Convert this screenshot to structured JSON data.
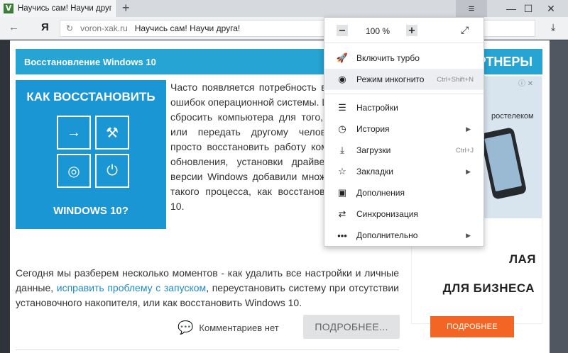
{
  "tab": {
    "favicon": "V",
    "title": "Научись сам! Научи друга",
    "close": "✕"
  },
  "window": {
    "new_tab": "+",
    "menu_icon": "≡",
    "min": "—",
    "max": "☐",
    "close": "✕"
  },
  "toolbar": {
    "back": "←",
    "logo": "Я",
    "refresh": "↻",
    "domain": "voron-xak.ru",
    "page_title": "Научись сам! Научи друга!",
    "download": "⤓"
  },
  "article": {
    "header": "Восстановление Windows 10",
    "image_title": "КАК ВОССТАНОВИТЬ",
    "image_subtitle": "WINDOWS 10?",
    "paragraph1": "Часто появляется потребность в Windows из-за ошибок операционной системы. Или необходимо сбросить компьютера для того, чтобы продать или передать другому человеку. требуется просто восстановить работу компьютера после обновления, установки драйверов последней версии Windows добавили множество функций, такого процесса, как восстановление Windows 10.",
    "paragraph2_part1": "Сегодня мы разберем несколько моментов - как удалить все настройки и личные данные, ",
    "paragraph2_link": "исправить проблему с запуском",
    "paragraph2_part2": ", переустановить систему при отсутствии установочного накопителя, или как восстановить Windows 10.",
    "comments": "Комментариев нет",
    "more_button": "ПОДРОБНЕЕ..."
  },
  "sidebar": {
    "header": "ПАРТНЕРЫ",
    "ad_brand": "ростелеком",
    "ad_line1": "ЛАЯ",
    "ad_line2": "ДЛЯ БИЗНЕСА",
    "ad_button": "ПОДРОБНЕЕ",
    "ad_badge": "ⓘ ✕"
  },
  "menu": {
    "zoom_minus": "−",
    "zoom_value": "100 %",
    "zoom_plus": "+",
    "fullscreen": "⤢",
    "items": [
      {
        "label": "Включить турбо",
        "icon": "rocket-icon",
        "glyph": "🚀",
        "shortcut": ""
      },
      {
        "label": "Режим инкогнито",
        "icon": "mask-icon",
        "glyph": "◉",
        "shortcut": "Ctrl+Shift+N"
      },
      {
        "label": "Настройки",
        "icon": "settings-icon",
        "glyph": "☰",
        "shortcut": ""
      },
      {
        "label": "История",
        "icon": "clock-icon",
        "glyph": "◷",
        "shortcut": ""
      },
      {
        "label": "Загрузки",
        "icon": "download-icon",
        "glyph": "⤓",
        "shortcut": "Ctrl+J"
      },
      {
        "label": "Закладки",
        "icon": "star-icon",
        "glyph": "☆",
        "shortcut": ""
      },
      {
        "label": "Дополнения",
        "icon": "extensions-icon",
        "glyph": "▣",
        "shortcut": ""
      },
      {
        "label": "Синхронизация",
        "icon": "sync-icon",
        "glyph": "⇄",
        "shortcut": ""
      },
      {
        "label": "Дополнительно",
        "icon": "more-icon",
        "glyph": "•••",
        "shortcut": ""
      }
    ],
    "submenu_arrow": "▶"
  },
  "colors": {
    "accent": "#26a4d3",
    "ad_button": "#f26524",
    "link": "#1f8cc4"
  }
}
